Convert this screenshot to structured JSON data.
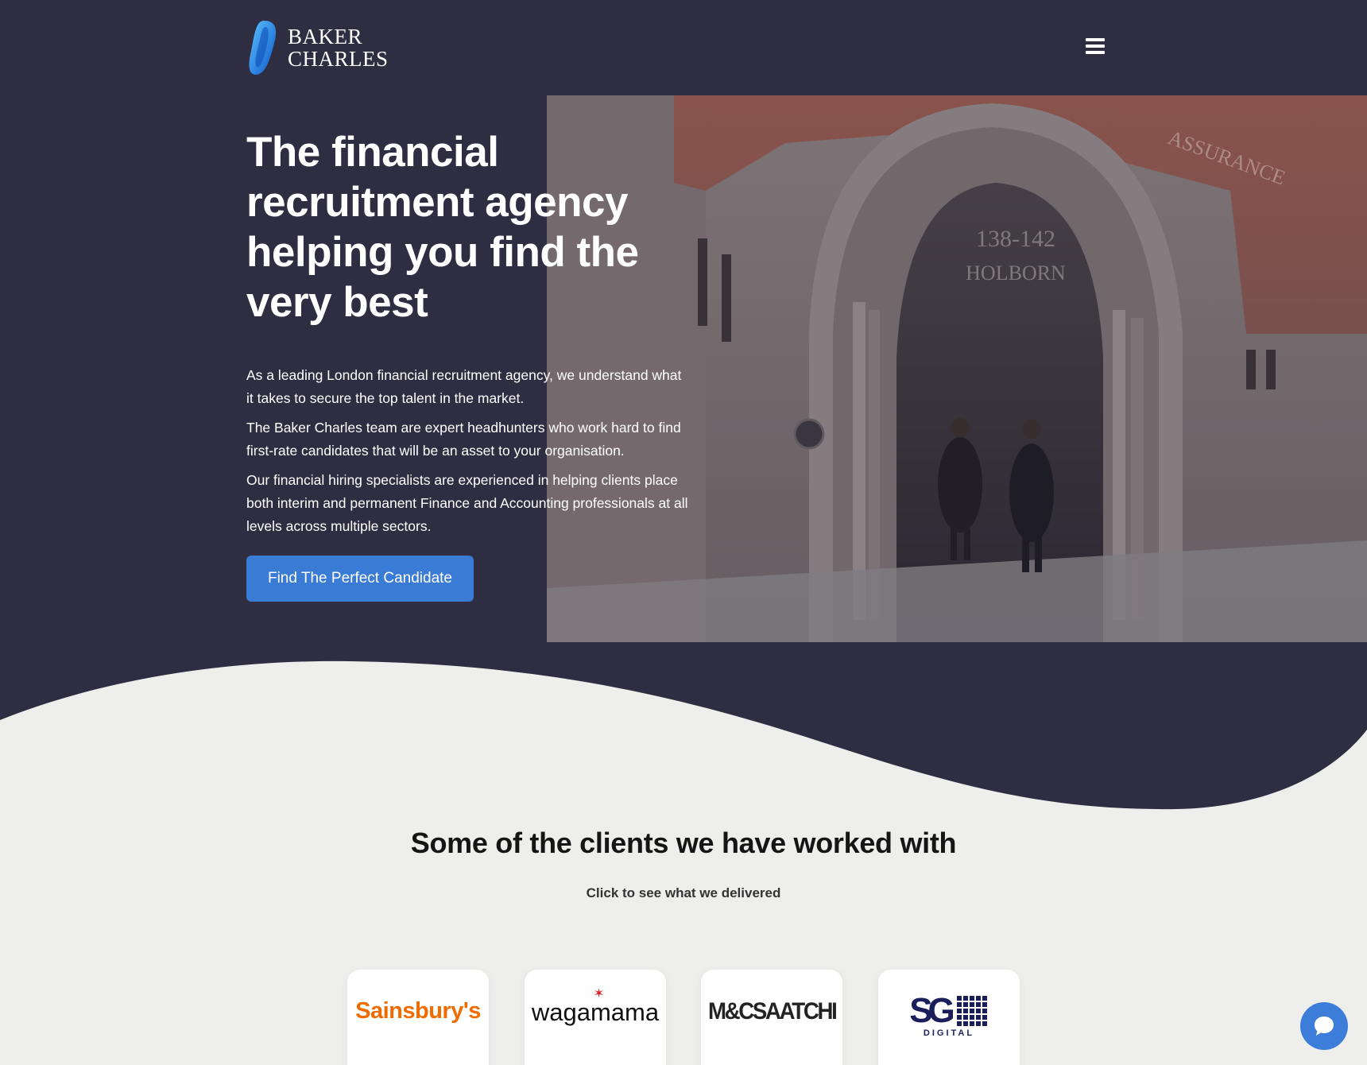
{
  "header": {
    "logo_line1": "BAKER",
    "logo_line2": "CHARLES",
    "menu_icon": "hamburger-menu-icon"
  },
  "hero": {
    "title": "The financial recruitment agency helping you find the very best",
    "paragraphs": [
      "As a leading London financial recruitment agency, we understand what it takes to secure the top talent in the market.",
      "The Baker Charles team are expert headhunters who work hard to find first-rate candidates that will be an asset to your organisation.",
      "Our financial hiring specialists are experienced in helping clients place both interim and permanent Finance and Accounting professionals at all levels across multiple sectors."
    ],
    "cta_label": "Find The Perfect Candidate",
    "photo_sign_line1": "138-142",
    "photo_sign_line2": "HOLBORN",
    "photo_facade_text": "ASSURANCE"
  },
  "clients": {
    "title": "Some of the clients we have worked with",
    "subtitle": "Click to see what we delivered",
    "logos": [
      {
        "name": "Sainsbury's",
        "color": "#f06c00"
      },
      {
        "name": "wagamama",
        "color": "#111111"
      },
      {
        "name": "M&CSAATCHI",
        "color": "#232323"
      },
      {
        "name": "SG",
        "sub": "DIGITAL",
        "color": "#1a1f5c"
      }
    ]
  },
  "chat": {
    "icon": "chat-bubble-icon"
  },
  "colors": {
    "hero_bg": "#2f2d41",
    "page_bg": "#eeeeec",
    "accent": "#3a7bd5"
  }
}
